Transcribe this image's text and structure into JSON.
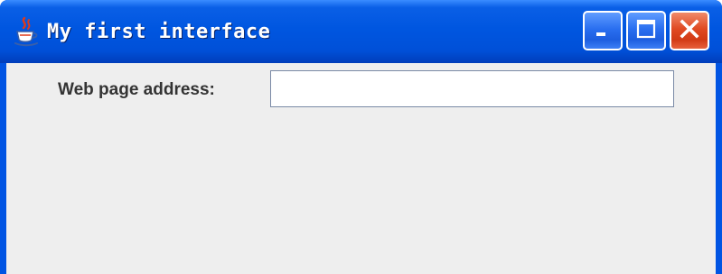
{
  "window": {
    "title": "My first interface",
    "app_icon": "java-cup-icon",
    "controls": {
      "minimize": "minimize-icon",
      "maximize": "maximize-icon",
      "close": "close-icon"
    }
  },
  "form": {
    "address_label": "Web page address:",
    "address_value": ""
  },
  "colors": {
    "titlebar": "#0054e3",
    "client_background": "#eeeeee",
    "close_button": "#e04a22"
  }
}
